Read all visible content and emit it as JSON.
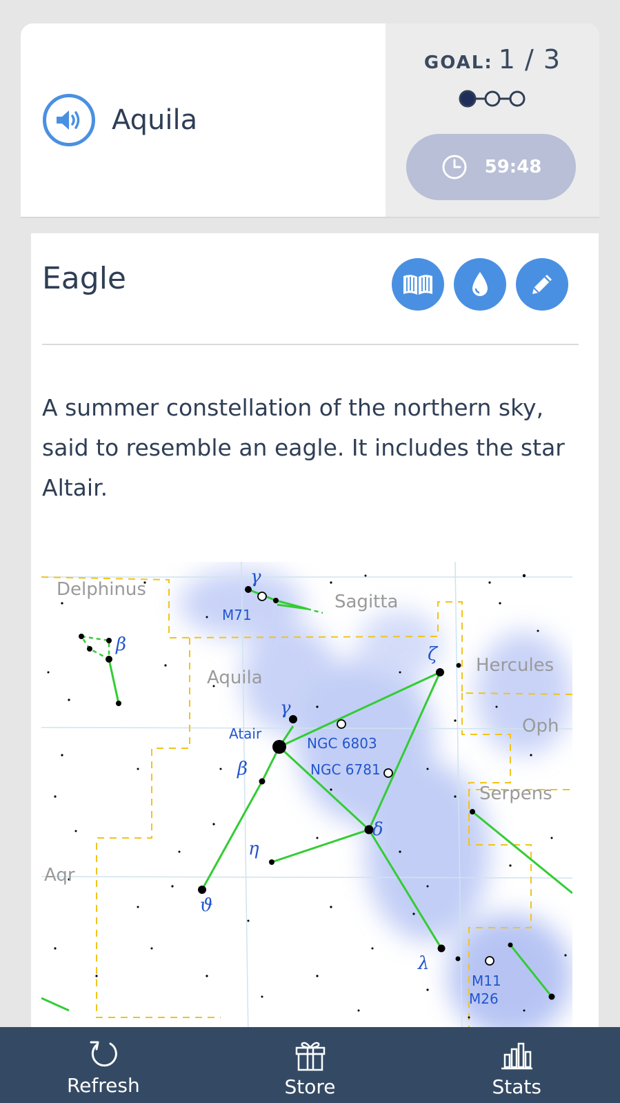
{
  "header": {
    "title": "Aquila",
    "goal_label": "GOAL:",
    "goal_value": "1 / 3",
    "goal_progress": 0.333,
    "timer": "59:48"
  },
  "card": {
    "word": "Eagle",
    "definition": "A summer constellation of the northern sky, said to resemble an eagle. It includes the star Altair."
  },
  "star_map": {
    "labels": {
      "delphinus": "Delphinus",
      "sagitta": "Sagitta",
      "hercules": "Hercules",
      "aquila": "Aquila",
      "oph": "Oph",
      "serpens": "Serpens",
      "aqr": "Aqr",
      "altair": "Atair",
      "m71": "M71",
      "ngc6803": "NGC 6803",
      "ngc6781": "NGC 6781",
      "m11": "M11",
      "m26": "M26",
      "gamma_sge": "γ",
      "beta_del": "β",
      "zeta": "ζ",
      "gamma": "γ",
      "beta": "β",
      "eta": "η",
      "delta": "δ",
      "theta": "ϑ",
      "lambda": "λ"
    }
  },
  "nav": {
    "refresh": "Refresh",
    "store": "Store",
    "stats": "Stats"
  },
  "colors": {
    "accent": "#4a90e2",
    "nav_bg": "#344a64",
    "timer_bg": "#b8bfd6",
    "text": "#2f3e55",
    "constellation_line": "#33cc33",
    "boundary": "#f0c419",
    "label_blue": "#2255cc"
  }
}
